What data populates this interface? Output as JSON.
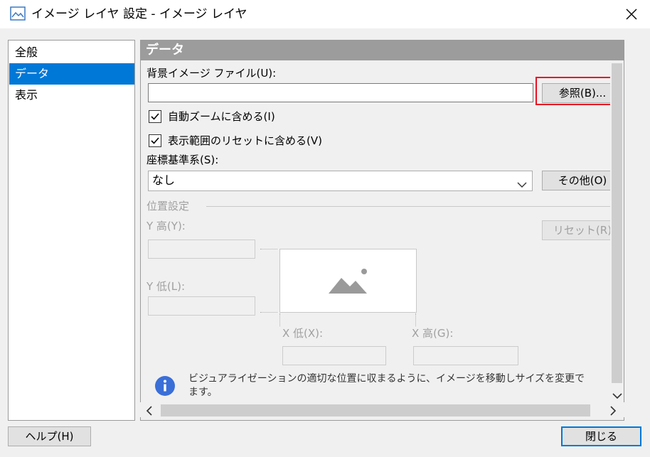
{
  "window": {
    "title": "イメージ レイヤ 設定 - イメージ レイヤ"
  },
  "nav": {
    "items": [
      {
        "label": "全般"
      },
      {
        "label": "データ",
        "selected": true
      },
      {
        "label": "表示"
      }
    ]
  },
  "data_panel": {
    "header": "データ",
    "bg_image_label": "背景イメージ ファイル(U):",
    "bg_image_value": "",
    "browse_button": "参照(B)...",
    "auto_zoom_label": "自動ズームに含める(I)",
    "auto_zoom_checked": true,
    "reset_extent_label": "表示範囲のリセットに含める(V)",
    "reset_extent_checked": true,
    "crs_label": "座標基準系(S):",
    "crs_value": "なし",
    "other_button": "その他(O)",
    "position_section": "位置設定",
    "y_high_label": "Y 高(Y):",
    "y_low_label": "Y 低(L):",
    "reset_button": "リセット(R)",
    "x_low_label": "X 低(X):",
    "x_high_label": "X 高(G):",
    "info_text_1": "ビジュアライゼーションの適切な位置に収まるように、イメージを移動しサイズを変更で",
    "info_text_2": "ます。"
  },
  "footer": {
    "help_button": "ヘルプ(H)",
    "close_button": "閉じる"
  },
  "colors": {
    "accent": "#0078d7",
    "highlight_box": "#e81123",
    "info_icon": "#3a6fd8",
    "panel_header": "#9c9c9c"
  },
  "icons": [
    "image-layer-icon",
    "close-icon",
    "checkbox-checked-icon",
    "chevron-down-icon",
    "image-placeholder-icon",
    "info-icon",
    "scroll-left-icon",
    "scroll-right-icon",
    "scroll-down-icon"
  ]
}
